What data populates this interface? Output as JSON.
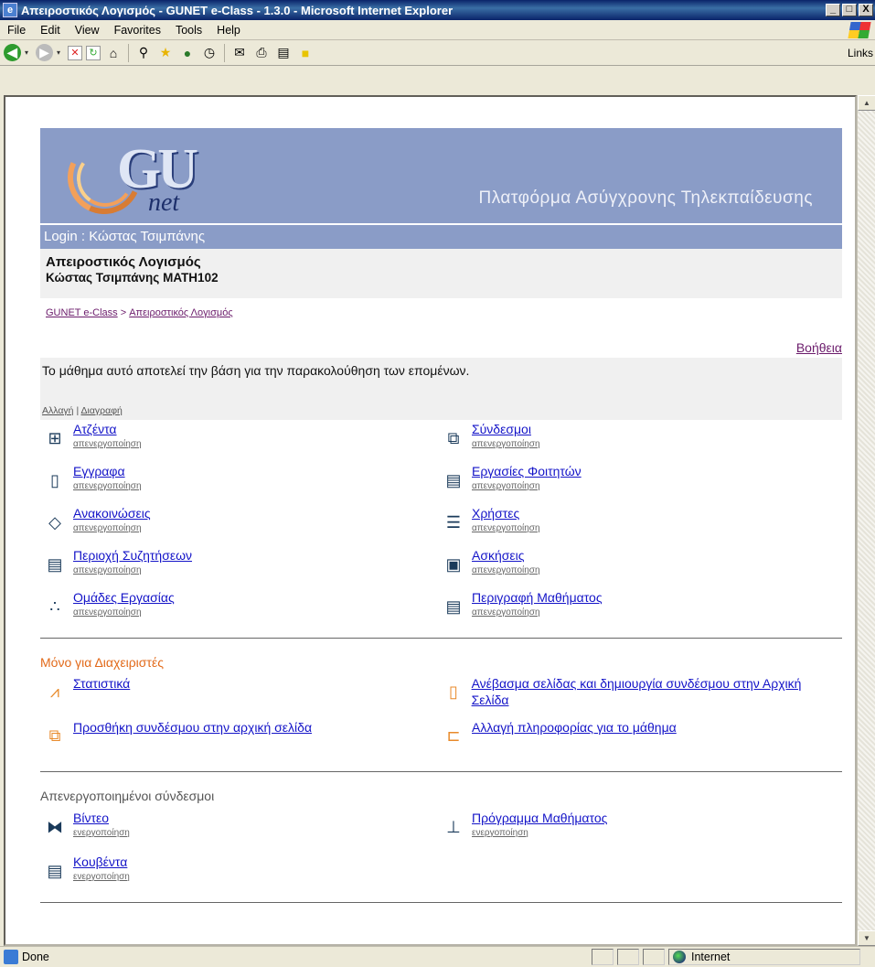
{
  "window": {
    "title": "Απειροστικός Λογισμός - GUNET e-Class - 1.3.0 - Microsoft Internet Explorer",
    "controls": [
      "_",
      "□",
      "X"
    ]
  },
  "menubar": [
    "File",
    "Edit",
    "View",
    "Favorites",
    "Tools",
    "Help"
  ],
  "toolbar": {
    "links_label": "Links"
  },
  "banner": {
    "logo_main": "GU",
    "logo_sub": "net",
    "platform": "Πλατφόρμα Ασύγχρονης Τηλεκπαίδευσης"
  },
  "login": "Login : Κώστας Τσιμπάνης",
  "course": {
    "title": "Απειροστικός Λογισμός",
    "subtitle": "Κώστας Τσιμπάνης MATH102"
  },
  "breadcrumb": {
    "home": "GUNET e-Class",
    "sep": ">",
    "current": "Απειροστικός Λογισμός"
  },
  "help": "Βοήθεια",
  "description": {
    "text": "Το μάθημα αυτό αποτελεί την βάση για την παρακολούθηση των επομένων.",
    "edit": "Αλλαγή",
    "sep": "|",
    "delete": "Διαγραφή"
  },
  "tools": [
    {
      "label": "Ατζέντα",
      "action": "απενεργοποίηση",
      "icon": "agenda-icon",
      "glyph": "⊞"
    },
    {
      "label": "Σύνδεσμοι",
      "action": "απενεργοποίηση",
      "icon": "links-icon",
      "glyph": "⧉"
    },
    {
      "label": "Εγγραφα",
      "action": "απενεργοποίηση",
      "icon": "documents-icon",
      "glyph": "▯"
    },
    {
      "label": "Εργασίες Φοιτητών",
      "action": "απενεργοποίηση",
      "icon": "student-works-icon",
      "glyph": "▤"
    },
    {
      "label": "Ανακοινώσεις",
      "action": "απενεργοποίηση",
      "icon": "announcements-icon",
      "glyph": "◇"
    },
    {
      "label": "Χρήστες",
      "action": "απενεργοποίηση",
      "icon": "users-icon",
      "glyph": "☰"
    },
    {
      "label": "Περιοχή Συζητήσεων",
      "action": "απενεργοποίηση",
      "icon": "forum-icon",
      "glyph": "▤"
    },
    {
      "label": "Ασκήσεις",
      "action": "απενεργοποίηση",
      "icon": "exercises-icon",
      "glyph": "▣"
    },
    {
      "label": "Ομάδες Εργασίας",
      "action": "απενεργοποίηση",
      "icon": "groups-icon",
      "glyph": "∴"
    },
    {
      "label": "Περιγραφή Μαθήματος",
      "action": "απενεργοποίηση",
      "icon": "course-description-icon",
      "glyph": "▤"
    }
  ],
  "admin": {
    "title": "Μόνο για Διαχειριστές",
    "items": [
      {
        "label": "Στατιστικά",
        "icon": "statistics-icon",
        "glyph": "⩘"
      },
      {
        "label": "Ανέβασμα σελίδας και δημιουργία συνδέσμου στην Αρχική Σελίδα",
        "icon": "upload-page-icon",
        "glyph": "▯"
      },
      {
        "label": "Προσθήκη συνδέσμου στην αρχική σελίδα",
        "icon": "add-link-icon",
        "glyph": "⧉"
      },
      {
        "label": "Αλλαγή πληροφορίας για το μάθημα",
        "icon": "course-info-icon",
        "glyph": "⊏"
      }
    ]
  },
  "inactive": {
    "title": "Απενεργοποιημένοι σύνδεσμοι",
    "items": [
      {
        "label": "Βίντεο",
        "action": "ενεργοποίηση",
        "icon": "video-icon",
        "glyph": "⧓"
      },
      {
        "label": "Πρόγραμμα Μαθήματος",
        "action": "ενεργοποίηση",
        "icon": "course-program-icon",
        "glyph": "⊥"
      },
      {
        "label": "Κουβέντα",
        "action": "ενεργοποίηση",
        "icon": "chat-icon",
        "glyph": "▤"
      }
    ]
  },
  "status": {
    "text": "Done",
    "zone": "Internet"
  },
  "colors": {
    "banner": "#8a9cc7",
    "link": "#1414c8",
    "admin": "#e26a1a",
    "visited": "#6b1b6b"
  }
}
